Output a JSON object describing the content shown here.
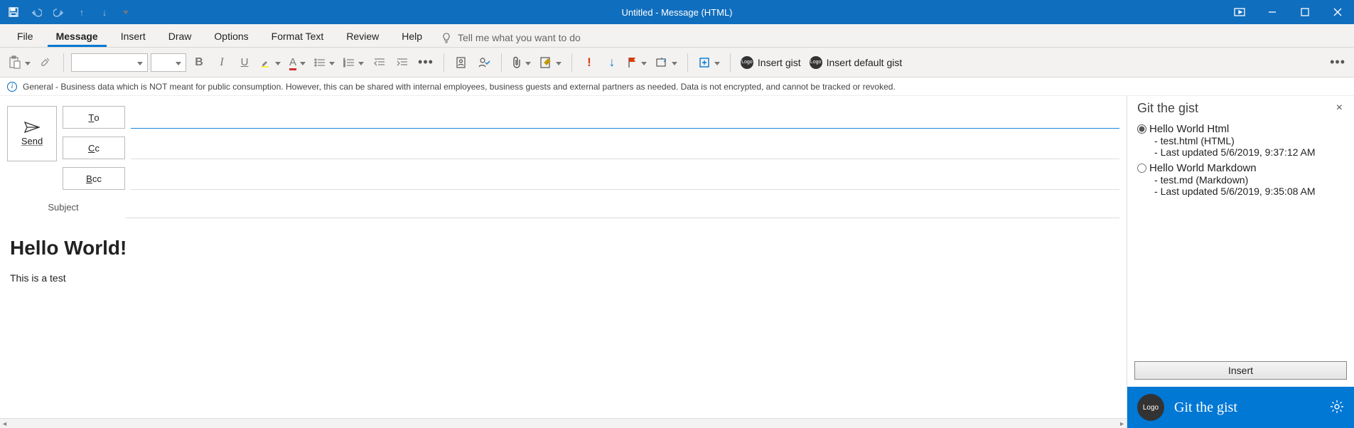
{
  "titlebar": {
    "title": "Untitled  -  Message (HTML)"
  },
  "tabs": {
    "file": "File",
    "message": "Message",
    "insert": "Insert",
    "draw": "Draw",
    "options": "Options",
    "format_text": "Format Text",
    "review": "Review",
    "help": "Help",
    "tellme": "Tell me what you want to do"
  },
  "ribbon": {
    "font_name": "",
    "font_size": "",
    "addin1": "Insert gist",
    "addin2": "Insert default gist",
    "logo_text": "Logo"
  },
  "infobar": {
    "text": "General - Business data which is NOT meant for public consumption. However, this can be shared with internal employees, business guests and external partners as needed. Data is not encrypted, and cannot be tracked or revoked."
  },
  "compose": {
    "to_label": "To",
    "cc_label": "Cc",
    "bcc_label": "Bcc",
    "send_label": "Send",
    "subject_label": "Subject",
    "to_value": "",
    "cc_value": "",
    "bcc_value": "",
    "subject_value": ""
  },
  "body": {
    "heading": "Hello World!",
    "paragraph": "This is a test"
  },
  "panel": {
    "title": "Git the gist",
    "close": "×",
    "gists": [
      {
        "title": "Hello World Html",
        "file": "test.html (HTML)",
        "updated": "Last updated 5/6/2019, 9:37:12 AM",
        "selected": true
      },
      {
        "title": "Hello World Markdown",
        "file": "test.md (Markdown)",
        "updated": "Last updated 5/6/2019, 9:35:08 AM",
        "selected": false
      }
    ],
    "insert_button": "Insert",
    "footer_logo": "Logo",
    "footer_title": "Git the gist"
  }
}
